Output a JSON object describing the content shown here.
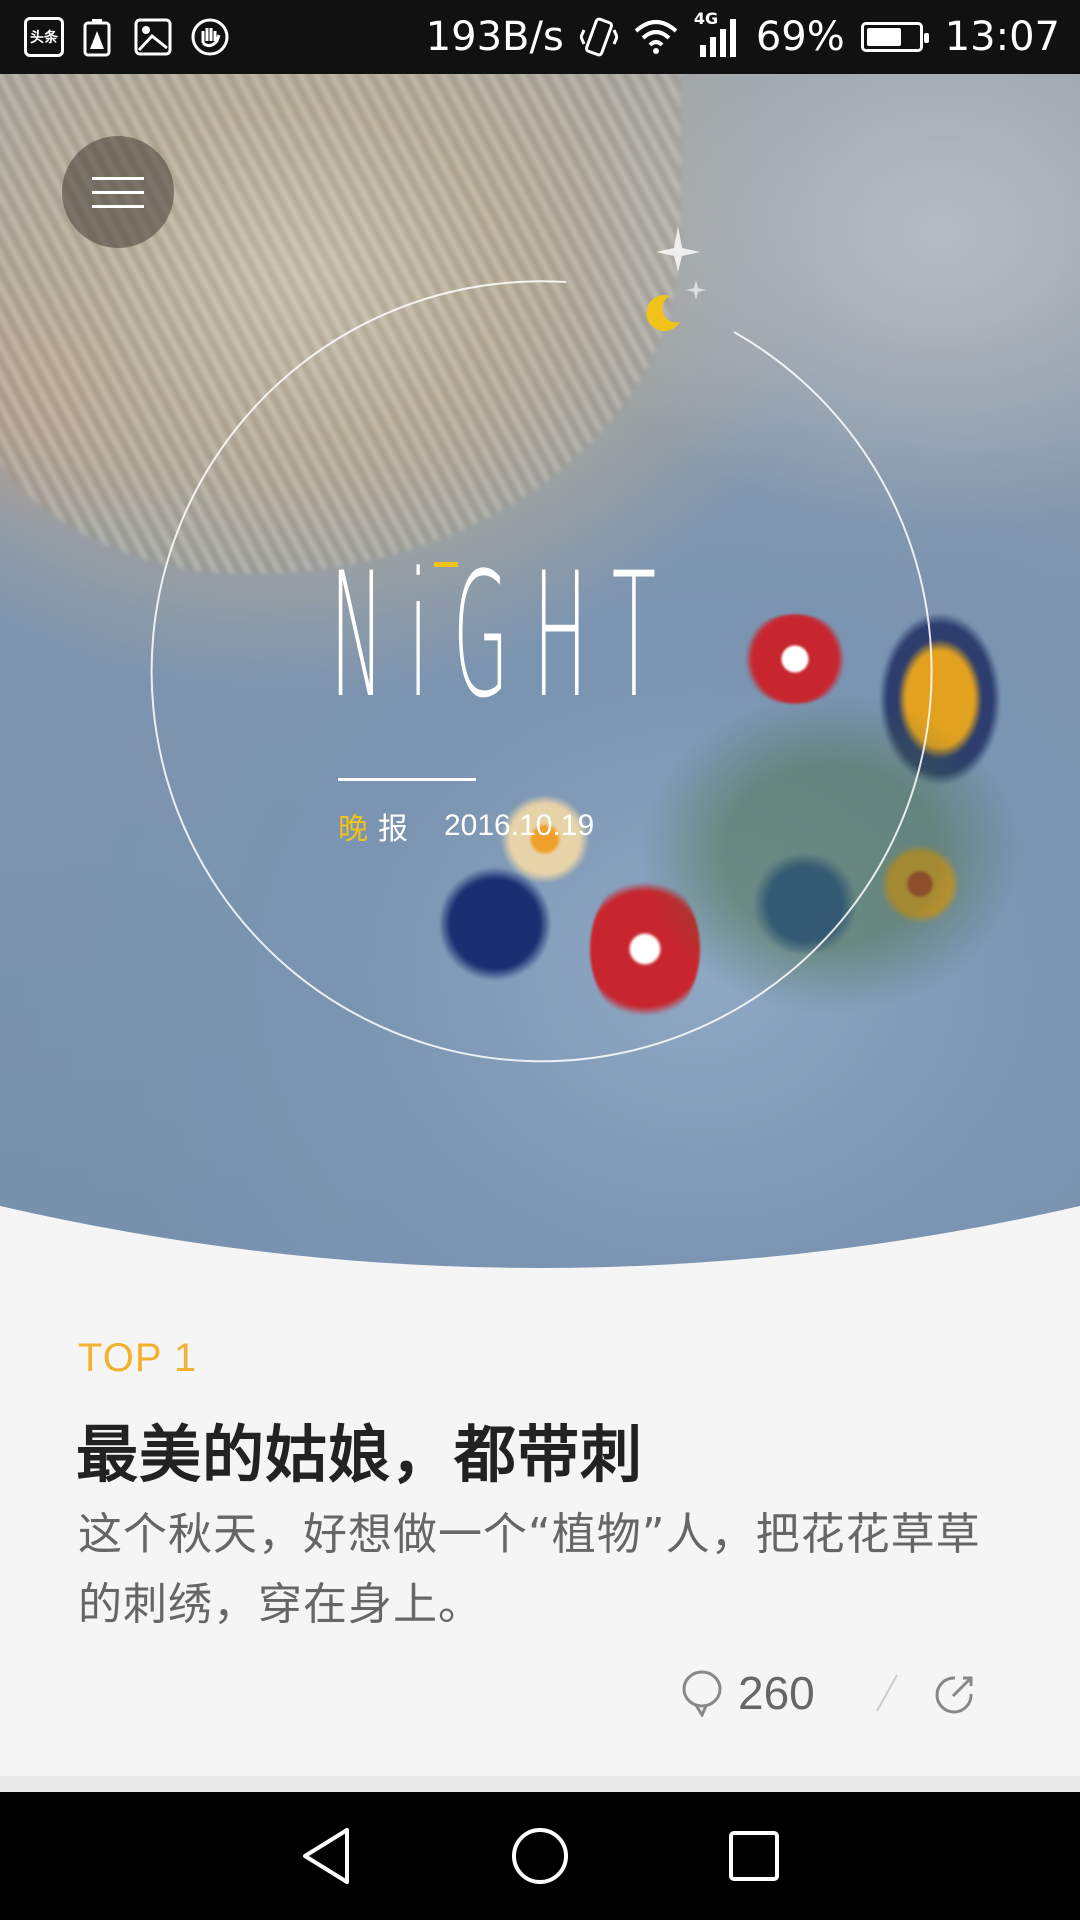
{
  "status_bar": {
    "net_speed": "193B/s",
    "network_type": "4G",
    "battery_percent": "69%",
    "battery_level": 0.69,
    "time": "13:07",
    "left_icons": [
      "toutiao-app-icon",
      "battery-warning-icon",
      "image-icon",
      "hand-icon"
    ]
  },
  "hero": {
    "brand_word": "NiGHT",
    "caption_highlight": "晚",
    "caption_rest": "报",
    "date": "2016.10.19",
    "accent_color": "#f0c21a"
  },
  "article": {
    "rank": "TOP 1",
    "title": "最美的姑娘，都带刺",
    "summary": "这个秋天，好想做一个“植物”人，把花花草草的刺绣，穿在身上。",
    "comment_count": "260",
    "accent_color": "#f2b12e"
  },
  "nav": {
    "icons": [
      "back-triangle-icon",
      "home-circle-icon",
      "recents-square-icon"
    ]
  }
}
